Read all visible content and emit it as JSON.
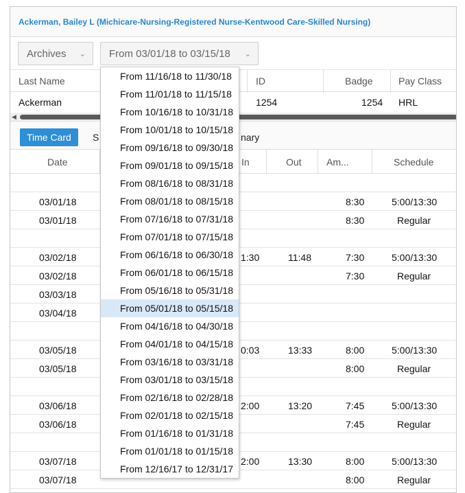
{
  "header": {
    "title": "Ackerman, Bailey L (Michicare-Nursing-Registered Nurse-Kentwood Care-Skilled Nursing)"
  },
  "filters": {
    "archives_label": "Archives",
    "range_label": "From 03/01/18 to 03/15/18"
  },
  "employee_table": {
    "columns": [
      "Last Name",
      "ID",
      "Badge",
      "Pay Class"
    ],
    "row": {
      "last_name": "Ackerman",
      "id": "1254",
      "badge": "1254",
      "pay_class": "HRL"
    }
  },
  "tabs": {
    "time_card": "Time Card",
    "second_tab_fragment": "S",
    "summary_fragment": "nary"
  },
  "timecard": {
    "columns": {
      "date": "Date",
      "in": "In",
      "out": "Out",
      "amount": "Am...",
      "schedule": "Schedule"
    },
    "rows": [
      {
        "date": "",
        "in": "",
        "out": "",
        "amount": "",
        "schedule": ""
      },
      {
        "date": "03/01/18",
        "in": "",
        "out": "",
        "amount": "8:30",
        "schedule": "5:00/13:30"
      },
      {
        "date": "03/01/18",
        "in": "",
        "out": "",
        "amount": "8:30",
        "schedule": "Regular"
      },
      {
        "date": "",
        "in": "",
        "out": "",
        "amount": "",
        "schedule": ""
      },
      {
        "date": "03/02/18",
        "in": "1:30",
        "out": "11:48",
        "amount": "7:30",
        "schedule": "5:00/13:30"
      },
      {
        "date": "03/02/18",
        "in": "",
        "out": "",
        "amount": "7:30",
        "schedule": "Regular"
      },
      {
        "date": "03/03/18",
        "in": "",
        "out": "",
        "amount": "",
        "schedule": ""
      },
      {
        "date": "03/04/18",
        "in": "",
        "out": "",
        "amount": "",
        "schedule": ""
      },
      {
        "date": "",
        "in": "",
        "out": "",
        "amount": "",
        "schedule": ""
      },
      {
        "date": "03/05/18",
        "in": "0:03",
        "out": "13:33",
        "amount": "8:00",
        "schedule": "5:00/13:30"
      },
      {
        "date": "03/05/18",
        "in": "",
        "out": "",
        "amount": "8:00",
        "schedule": "Regular"
      },
      {
        "date": "",
        "in": "",
        "out": "",
        "amount": "",
        "schedule": ""
      },
      {
        "date": "03/06/18",
        "in": "2:00",
        "out": "13:20",
        "amount": "7:45",
        "schedule": "5:00/13:30"
      },
      {
        "date": "03/06/18",
        "in": "",
        "out": "",
        "amount": "7:45",
        "schedule": "Regular"
      },
      {
        "date": "",
        "in": "",
        "out": "",
        "amount": "",
        "schedule": ""
      },
      {
        "date": "03/07/18",
        "in": "2:00",
        "out": "13:30",
        "amount": "8:00",
        "schedule": "5:00/13:30"
      },
      {
        "date": "03/07/18",
        "in": "",
        "out": "",
        "amount": "8:00",
        "schedule": "Regular"
      }
    ]
  },
  "dropdown": {
    "highlighted_index": 13,
    "options": [
      "From 11/16/18 to 11/30/18",
      "From 11/01/18 to 11/15/18",
      "From 10/16/18 to 10/31/18",
      "From 10/01/18 to 10/15/18",
      "From 09/16/18 to 09/30/18",
      "From 09/01/18 to 09/15/18",
      "From 08/16/18 to 08/31/18",
      "From 08/01/18 to 08/15/18",
      "From 07/16/18 to 07/31/18",
      "From 07/01/18 to 07/15/18",
      "From 06/16/18 to 06/30/18",
      "From 06/01/18 to 06/15/18",
      "From 05/16/18 to 05/31/18",
      "From 05/01/18 to 05/15/18",
      "From 04/16/18 to 04/30/18",
      "From 04/01/18 to 04/15/18",
      "From 03/16/18 to 03/31/18",
      "From 03/01/18 to 03/15/18",
      "From 02/16/18 to 02/28/18",
      "From 02/01/18 to 02/15/18",
      "From 01/16/18 to 01/31/18",
      "From 01/01/18 to 01/15/18",
      "From 12/16/17 to 12/31/17"
    ]
  }
}
